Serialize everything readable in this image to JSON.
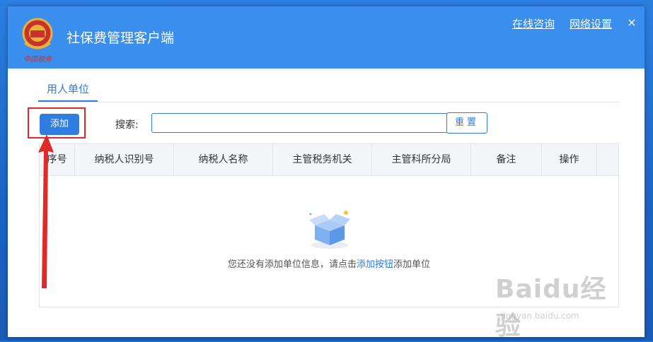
{
  "app": {
    "title": "社保费管理客户端",
    "logo_text": "中国税务"
  },
  "header_links": {
    "consult": "在线咨询",
    "network": "网络设置",
    "close": "×"
  },
  "tabs": [
    {
      "label": "用人单位"
    }
  ],
  "toolbar": {
    "add_label": "添加",
    "search_label": "搜索:",
    "search_value": "",
    "search_placeholder": "",
    "reset_label": "重置"
  },
  "table": {
    "columns": [
      "序号",
      "纳税人识别号",
      "纳税人名称",
      "主管税务机关",
      "主管科所分局",
      "备注",
      "操作"
    ],
    "rows": []
  },
  "empty_state": {
    "text_before": "您还没有添加单位信息，请点击",
    "link": "添加按钮",
    "text_after": "添加单位"
  },
  "watermark": {
    "main": "Baidu经验",
    "sub": "jingyan.baidu.com"
  },
  "colors": {
    "titlebar": "#3a8fee",
    "accent": "#2f7de1",
    "annotation": "#e02a2a"
  },
  "icons": {
    "logo": "tax-emblem-icon",
    "close": "close-icon",
    "empty": "empty-box-icon"
  }
}
